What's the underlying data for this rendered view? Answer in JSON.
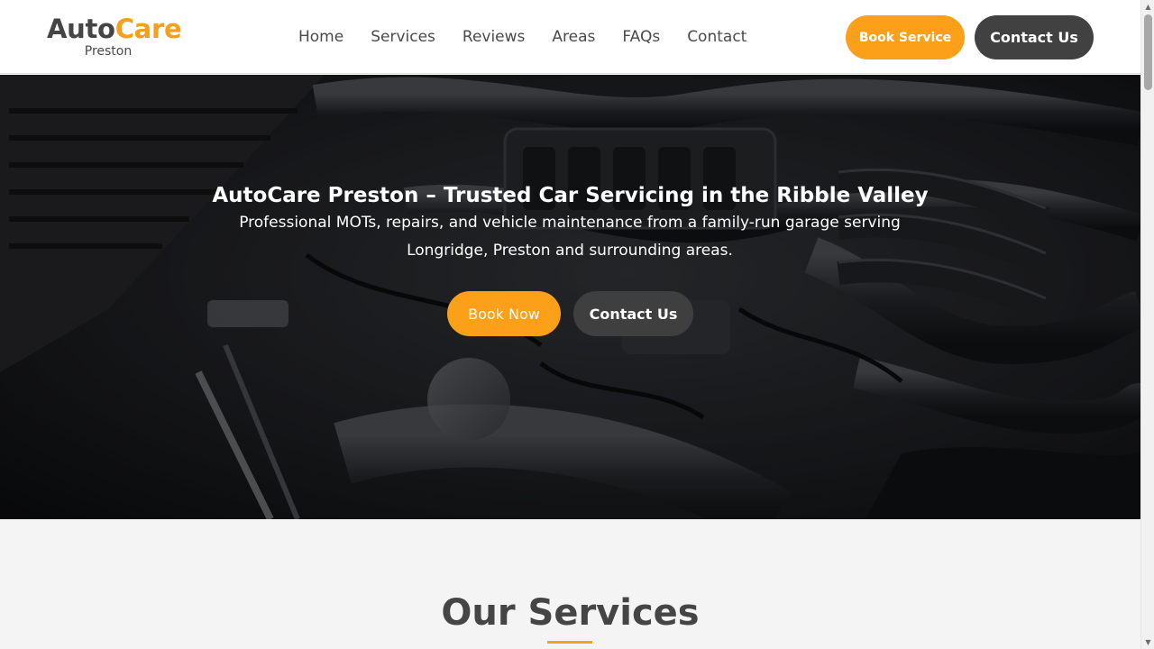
{
  "header": {
    "logo": {
      "auto": "Auto",
      "care": "Care",
      "location": "Preston"
    },
    "nav": [
      "Home",
      "Services",
      "Reviews",
      "Areas",
      "FAQs",
      "Contact"
    ],
    "book_service_label": "Book Service",
    "contact_label": "Contact Us"
  },
  "hero": {
    "title": "AutoCare Preston – Trusted Car Servicing in the Ribble Valley",
    "subtitle": "Professional MOTs, repairs, and vehicle maintenance from a family-run garage serving Longridge, Preston and surrounding areas.",
    "book_now_label": "Book Now",
    "contact_label": "Contact Us",
    "image": "car-engine-bay-photo"
  },
  "services": {
    "title": "Our Services"
  },
  "scrollbar": {
    "up_icon": "triangle-up-icon",
    "down_icon": "triangle-down-icon"
  },
  "colors": {
    "accent": "#fca01a",
    "dark_button": "#414141",
    "text": "#4a4a4a",
    "section_bg": "#f4f4f4"
  }
}
